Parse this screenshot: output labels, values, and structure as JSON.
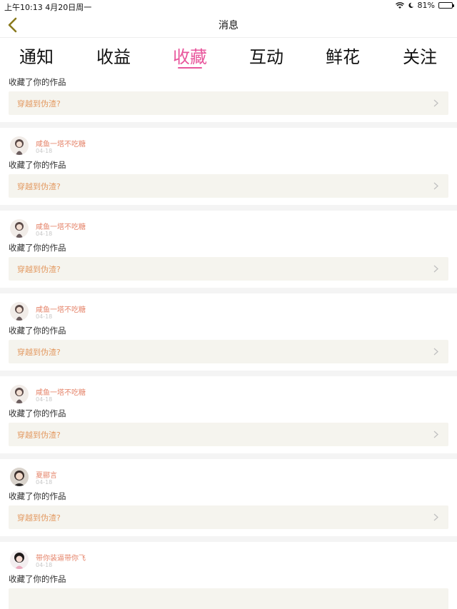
{
  "status_bar": {
    "time_date": "上午10:13   4月20日周一",
    "battery": "81%",
    "battery_level": 0.81
  },
  "nav": {
    "title": "消息",
    "back_icon": "chevron-left-icon"
  },
  "tabs": [
    {
      "label": "通知",
      "active": false
    },
    {
      "label": "收益",
      "active": false
    },
    {
      "label": "收藏",
      "active": true
    },
    {
      "label": "互动",
      "active": false
    },
    {
      "label": "鲜花",
      "active": false
    },
    {
      "label": "关注",
      "active": false
    }
  ],
  "colors": {
    "accent": "#e8569c",
    "username": "#e5846a",
    "link": "#e39a62",
    "link_bg": "#f5f4ee"
  },
  "partial_top": {
    "message": "收藏了你的作品",
    "work": "穿越到伪渣?"
  },
  "items": [
    {
      "user": "咸鱼一塔不吃糖",
      "date": "04-18",
      "message": "收藏了你的作品",
      "work": "穿越到伪渣?"
    },
    {
      "user": "咸鱼一塔不吃糖",
      "date": "04-18",
      "message": "收藏了你的作品",
      "work": "穿越到伪渣?"
    },
    {
      "user": "咸鱼一塔不吃糖",
      "date": "04-18",
      "message": "收藏了你的作品",
      "work": "穿越到伪渣?"
    },
    {
      "user": "咸鱼一塔不吃糖",
      "date": "04-18",
      "message": "收藏了你的作品",
      "work": "穿越到伪渣?"
    },
    {
      "user": "夏郦言",
      "date": "04-18",
      "message": "收藏了你的作品",
      "work": "穿越到伪渣?"
    },
    {
      "user": "带你装逼带你飞",
      "date": "04-18",
      "message": "收藏了你的作品",
      "work": ""
    }
  ]
}
